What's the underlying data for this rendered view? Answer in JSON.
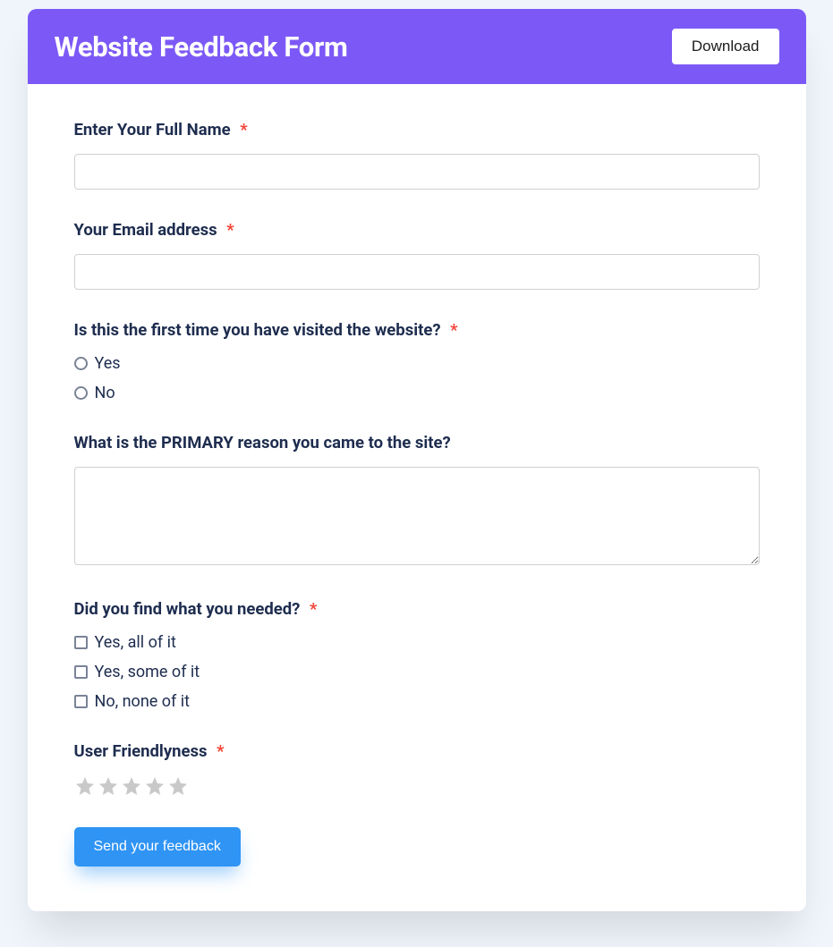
{
  "header": {
    "title": "Website Feedback Form",
    "download_label": "Download"
  },
  "fields": {
    "name": {
      "label": "Enter Your Full Name",
      "required": true
    },
    "email": {
      "label": "Your Email address",
      "required": true
    },
    "first_visit": {
      "label": "Is this the first time you have visited the website?",
      "required": true,
      "options": [
        "Yes",
        "No"
      ]
    },
    "primary_reason": {
      "label": "What is the PRIMARY reason you came to the site?",
      "required": false
    },
    "found_needed": {
      "label": "Did you find what you needed?",
      "required": true,
      "options": [
        "Yes, all of it",
        "Yes, some of it",
        "No, none of it"
      ]
    },
    "user_friendliness": {
      "label": "User Friendlyness",
      "required": true,
      "star_count": 5
    }
  },
  "submit_label": "Send your feedback"
}
